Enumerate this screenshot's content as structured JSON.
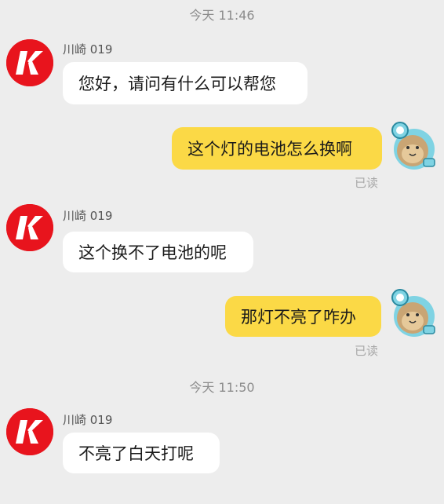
{
  "timestamps": [
    "今天 11:46",
    "今天 11:50"
  ],
  "messages": [
    {
      "sender": "川崎 019",
      "text": "您好，请问有什么可以帮您"
    },
    {
      "text": "这个灯的电池怎么换啊",
      "status": "已读"
    },
    {
      "sender": "川崎 019",
      "text": "这个换不了电池的呢"
    },
    {
      "text": "那灯不亮了咋办",
      "status": "已读"
    },
    {
      "sender": "川崎 019",
      "text": "不亮了白天打呢"
    }
  ],
  "colors": {
    "background": "#ededed",
    "incoming_bubble": "#ffffff",
    "outgoing_bubble": "#fbd946",
    "merchant_avatar": "#e8141d"
  },
  "icons": {
    "merchant_avatar": "kawasaki-k-logo-icon",
    "user_avatar": "cartoon-bear-avatar-icon"
  }
}
